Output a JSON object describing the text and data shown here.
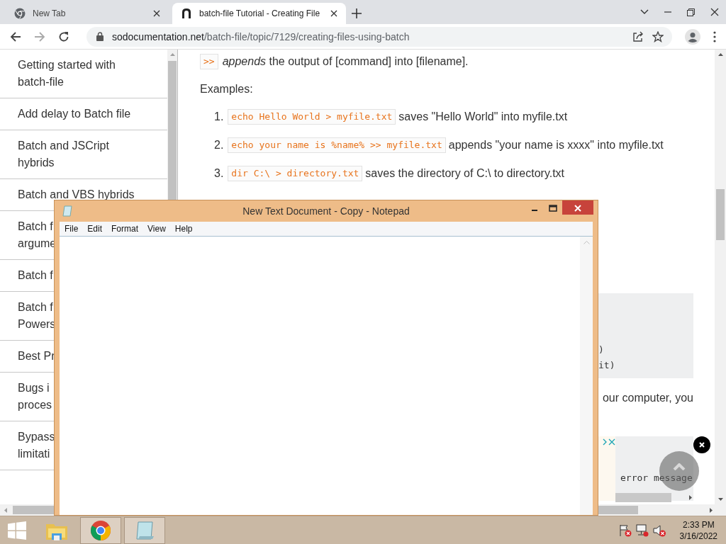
{
  "browser": {
    "tabs": [
      {
        "kind": "newtab",
        "title": "New Tab",
        "selected": false
      },
      {
        "kind": "site",
        "title": "batch-file Tutorial - Creating File",
        "selected": true
      }
    ],
    "address": {
      "host": "sodocumentation.net",
      "path": "/batch-file/topic/7129/creating-files-using-batch"
    }
  },
  "sidebar": {
    "items": [
      {
        "lines": [
          "Getting started with",
          "batch-file"
        ]
      },
      {
        "lines": [
          "Add delay to Batch file"
        ]
      },
      {
        "lines": [
          "Batch and JSCript",
          "hybrids"
        ]
      },
      {
        "lines": [
          "Batch and VBS hybrids"
        ]
      },
      {
        "lines": [
          "Batch f",
          "argume"
        ]
      },
      {
        "lines": [
          "Batch f"
        ]
      },
      {
        "lines": [
          "Batch f",
          "Powers"
        ]
      },
      {
        "lines": [
          "Best Pr"
        ]
      },
      {
        "lines": [
          "Bugs i",
          "proces"
        ]
      },
      {
        "lines": [
          "Bypass",
          "limitati"
        ]
      }
    ]
  },
  "article": {
    "intro": {
      "code": ">>",
      "text": "*appends* the output of [command] into [filename]."
    },
    "examples_label": "Examples:",
    "examples": [
      {
        "number": "1.",
        "code": "echo Hello World > myfile.txt",
        "text": "saves \"Hello World\" into myfile.txt"
      },
      {
        "number": "2.",
        "code": "echo your name is %name% >> myfile.txt",
        "text": "appends \"your name is xxxx\" into myfile.txt"
      },
      {
        "number": "3.",
        "code": "dir C:\\ > directory.txt",
        "text": "saves the directory of C:\\ to directory.txt"
      }
    ],
    "code_block_lines": [
      ")",
      "it)"
    ],
    "paragraph": "our computer, you",
    "code_block_2_lines": [
      "error message"
    ]
  },
  "notepad": {
    "title": "New Text Document - Copy - Notepad",
    "menu": [
      "File",
      "Edit",
      "Format",
      "View",
      "Help"
    ]
  },
  "taskbar": {
    "apps": [
      {
        "kind": "explorer",
        "active": false
      },
      {
        "kind": "chrome",
        "active": true
      },
      {
        "kind": "notepad",
        "active": true
      }
    ],
    "clock": {
      "time": "2:33 PM",
      "date": "3/16/2022"
    }
  }
}
